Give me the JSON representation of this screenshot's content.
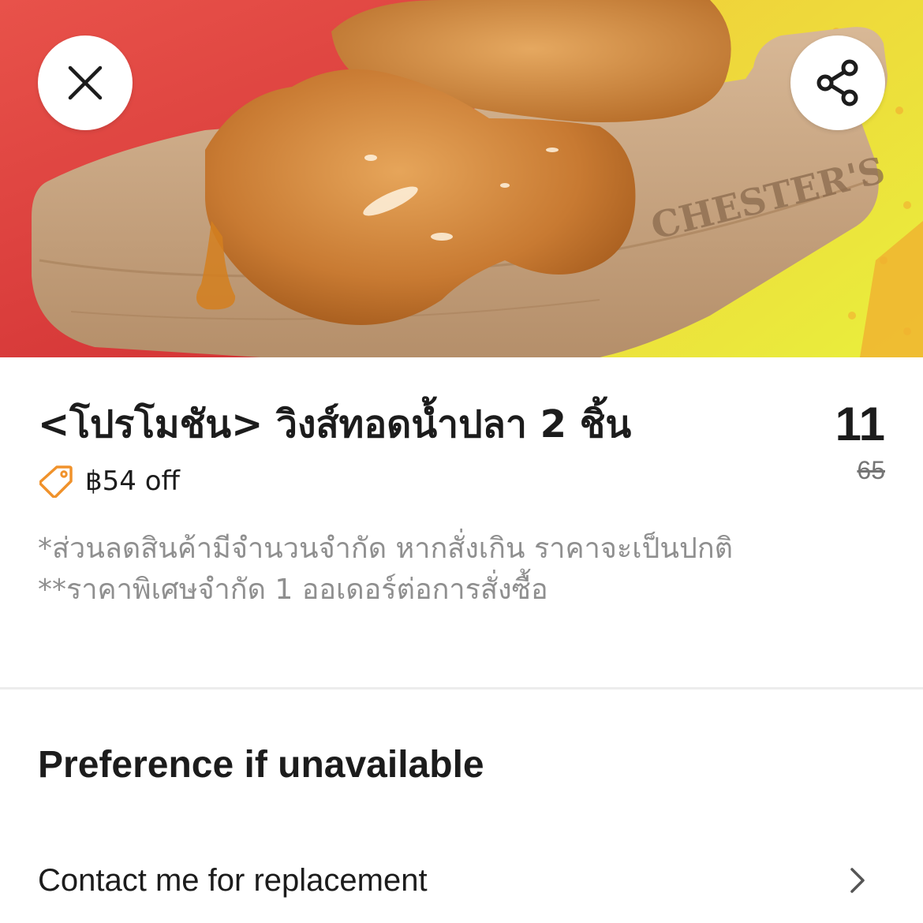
{
  "hero": {
    "close_icon": "close-icon",
    "share_icon": "share-icon",
    "brand_mark": "CHESTER'S"
  },
  "product": {
    "title": "<โปรโมชัน> วิงส์ทอดน้ำปลา 2 ชิ้น",
    "price": "11",
    "original_price": "65",
    "discount_icon": "tag-icon",
    "discount_label": "฿54 off",
    "note_line_1": "*ส่วนลดสินค้ามีจำนวนจำกัด หากสั่งเกิน ราคาจะเป็นปกติ",
    "note_line_2": "**ราคาพิเศษจำกัด 1 ออเดอร์ต่อการสั่งซื้อ"
  },
  "preference": {
    "section_title": "Preference if unavailable",
    "option_label": "Contact me for replacement",
    "option_icon": "chevron-right-icon"
  },
  "colors": {
    "discount_accent": "#f0922b",
    "text_primary": "#1c1c1c",
    "text_muted": "#8f8f8f"
  }
}
